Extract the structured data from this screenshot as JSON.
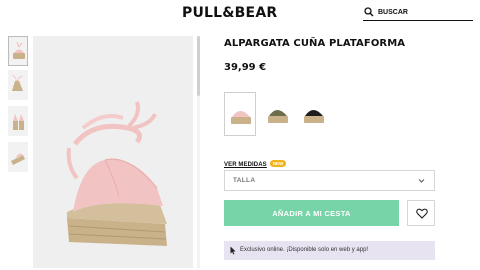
{
  "header": {
    "logo": "PULL&BEAR",
    "search_placeholder": "BUSCAR"
  },
  "product": {
    "title": "ALPARGATA CUÑA PLATAFORMA",
    "price": "39,99 €",
    "colors": [
      "pink",
      "khaki",
      "black"
    ],
    "selected_color_index": 0
  },
  "size_guide": {
    "link": "VER MEDIDAS",
    "badge": "NEW"
  },
  "size_select": {
    "label": "TALLA"
  },
  "actions": {
    "add_to_cart": "AÑADIR A MI CESTA"
  },
  "notice": {
    "text": "Exclusivo online. ¡Disponible solo en web y app!"
  },
  "colors": {
    "add_button": "#77d3a8",
    "notice_bg": "#e7e3f1",
    "badge": "#f2b21d",
    "shoe_pink": "#f2c3c3",
    "jute": "#c9b18a"
  }
}
